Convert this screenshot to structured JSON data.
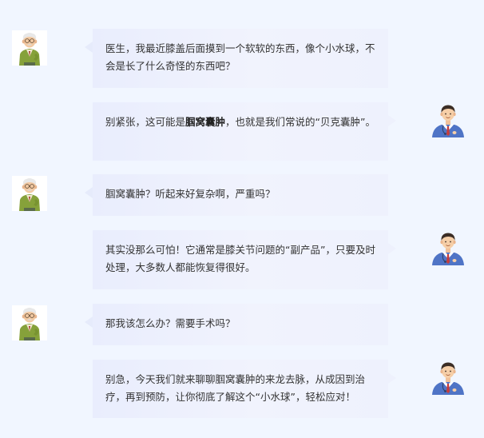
{
  "messages": [
    {
      "side": "left",
      "role": "patient",
      "text": "医生，我最近膝盖后面摸到一个软软的东西，像个小水球，不会是长了什么奇怪的东西吧？"
    },
    {
      "side": "right",
      "role": "doctor",
      "text_before": "别紧张，这可能是",
      "bold": "腘窝囊肿",
      "text_after": "，也就是我们常说的“贝克囊肿”。"
    },
    {
      "side": "left",
      "role": "patient",
      "text": "腘窝囊肿？听起来好复杂啊，严重吗？"
    },
    {
      "side": "right",
      "role": "doctor",
      "text": "其实没那么可怕！它通常是膝关节问题的“副产品”，只要及时处理，大多数人都能恢复得很好。"
    },
    {
      "side": "left",
      "role": "patient",
      "text": "那我该怎么办？需要手术吗？"
    },
    {
      "side": "right",
      "role": "doctor",
      "text": "别急，今天我们就来聊聊腘窝囊肿的来龙去脉，从成因到治疗，再到预防，让你彻底了解这个“小水球”，轻松应对！"
    }
  ],
  "colors": {
    "background": "#f1f6ff",
    "bubble": "#eceffd",
    "text": "#333333",
    "doctor_coat": "#4f74c6",
    "patient_sweater": "#87a23a"
  },
  "icons": {
    "patient_avatar": "elderly-man-avatar-icon",
    "doctor_avatar": "doctor-avatar-icon"
  }
}
